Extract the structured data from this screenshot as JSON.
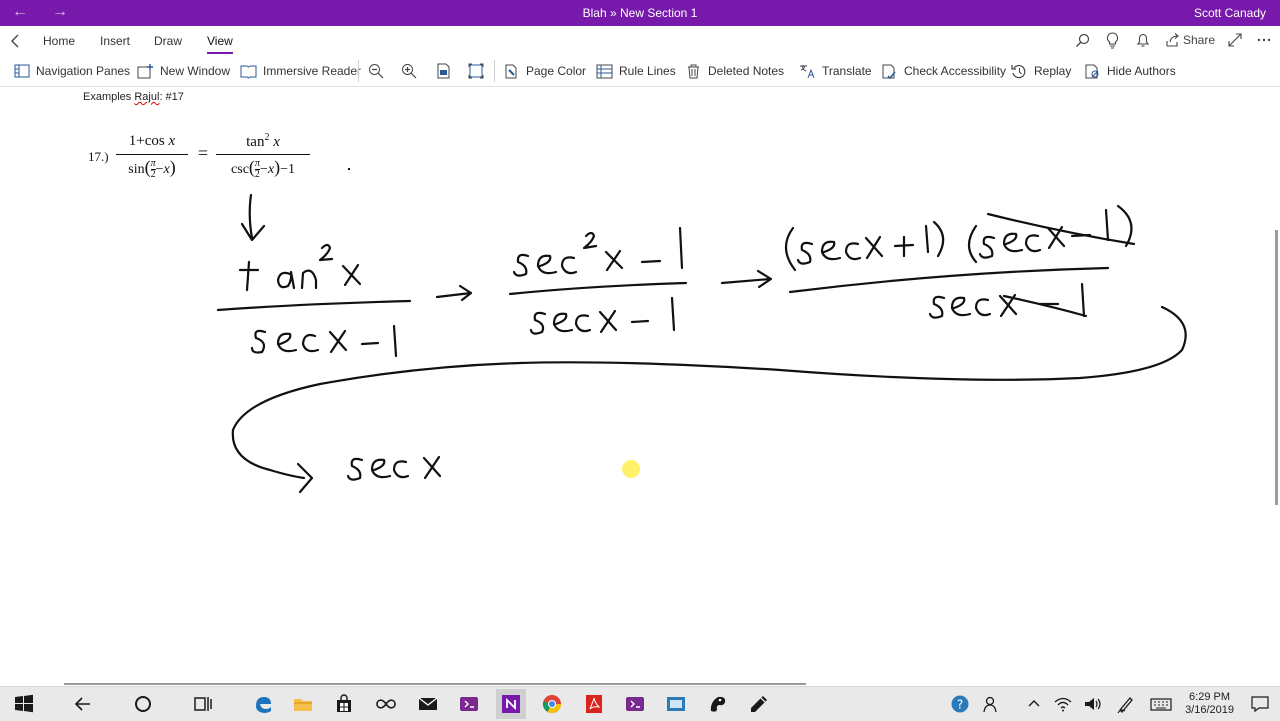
{
  "window": {
    "title": "Blah » New Section 1",
    "user": "Scott Canady",
    "back_glyph": "←",
    "forward_glyph": "→"
  },
  "tabs": [
    {
      "label": "Home"
    },
    {
      "label": "Insert"
    },
    {
      "label": "Draw"
    },
    {
      "label": "View"
    }
  ],
  "header_actions": {
    "share_label": "Share"
  },
  "ribbon": {
    "navigation_panes": "Navigation Panes",
    "new_window": "New Window",
    "immersive_reader": "Immersive Reader",
    "page_color": "Page Color",
    "rule_lines": "Rule Lines",
    "deleted_notes": "Deleted Notes",
    "translate": "Translate",
    "check_accessibility": "Check Accessibility",
    "replay": "Replay",
    "hide_authors": "Hide Authors"
  },
  "page": {
    "title_prefix": "Examples ",
    "title_squiggly": "Rajul",
    "title_suffix": ": #17",
    "problem_number": "17.)",
    "lhs_numerator": "1+cos",
    "lhs_numerator_var": "x",
    "lhs_denominator_fn": "sin",
    "lhs_denominator_pi": "π",
    "lhs_denominator_two": "2",
    "lhs_denominator_tail": "−",
    "lhs_denominator_var": "x",
    "equals": "=",
    "rhs_numerator_fn": "tan",
    "rhs_numerator_exp": "2",
    "rhs_numerator_var": "x",
    "rhs_denominator_fn": "csc",
    "rhs_denominator_pi": "π",
    "rhs_denominator_two": "2",
    "rhs_denominator_minus": "−",
    "rhs_denominator_var": "x",
    "rhs_denominator_tail": "−1"
  },
  "taskbar": {
    "time": "6:29 PM",
    "date": "3/16/2019"
  },
  "icons": {
    "search": "search-icon",
    "lightbulb": "lightbulb-icon",
    "bell": "bell-icon",
    "share": "share-icon",
    "expand": "expand-icon",
    "more": "more-icon"
  },
  "colors": {
    "accent": "#7719aa",
    "laser_pointer": "#ffef5a"
  }
}
